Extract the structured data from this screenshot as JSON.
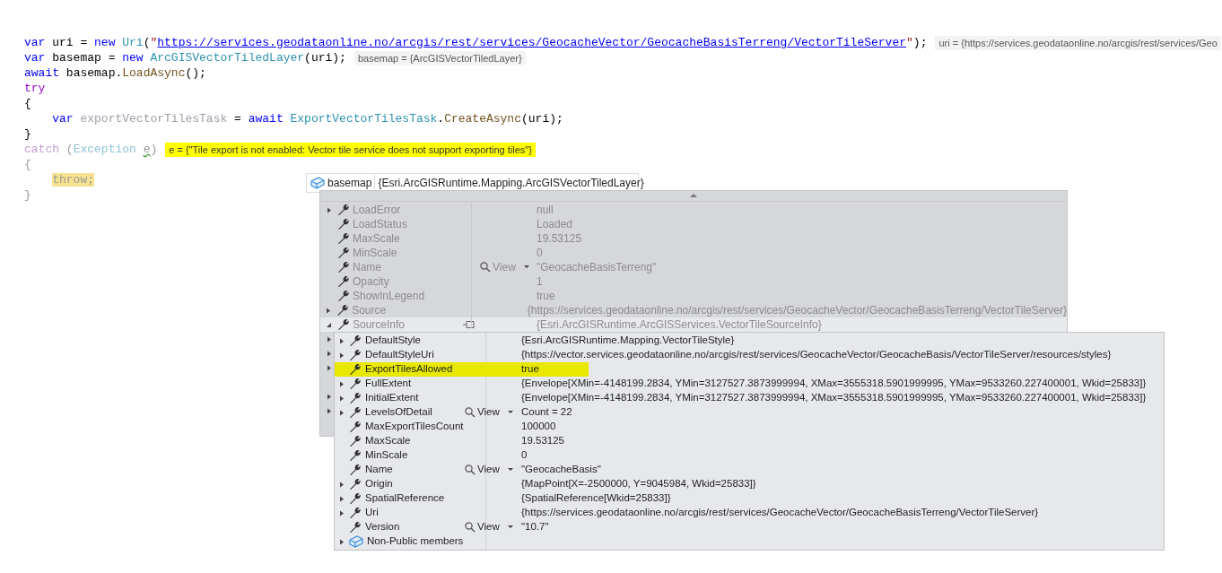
{
  "code_lines": [
    {
      "tokens": [
        {
          "kind": "keyword",
          "text": "var"
        },
        {
          "kind": "plain",
          "text": " uri = "
        },
        {
          "kind": "keyword",
          "text": "new"
        },
        {
          "kind": "type",
          "text": " Uri"
        },
        {
          "kind": "plain",
          "text": "("
        },
        {
          "kind": "string",
          "text": "\""
        },
        {
          "kind": "link",
          "text": "https://services.geodataonline.no/arcgis/rest/services/GeocacheVector/GeocacheBasisTerreng/VectorTileServer"
        },
        {
          "kind": "string",
          "text": "\""
        },
        {
          "kind": "plain",
          "text": ");"
        }
      ],
      "hint": {
        "kind": "datatip",
        "text": "uri = {https://services.geodataonline.no/arcgis/rest/services/Geo"
      }
    },
    {
      "tokens": [
        {
          "kind": "keyword",
          "text": "var"
        },
        {
          "kind": "plain",
          "text": " basemap = "
        },
        {
          "kind": "keyword",
          "text": "new"
        },
        {
          "kind": "type",
          "text": " ArcGISVectorTiledLayer"
        },
        {
          "kind": "plain",
          "text": "(uri);"
        }
      ],
      "hint": {
        "kind": "datatip",
        "text": "basemap = {ArcGISVectorTiledLayer}"
      }
    },
    {
      "tokens": [
        {
          "kind": "keyword",
          "text": "await"
        },
        {
          "kind": "plain",
          "text": " basemap."
        },
        {
          "kind": "method",
          "text": "LoadAsync"
        },
        {
          "kind": "plain",
          "text": "();"
        }
      ]
    },
    {
      "tokens": [
        {
          "kind": "control",
          "text": "try"
        }
      ]
    },
    {
      "tokens": [
        {
          "kind": "plain",
          "text": "{"
        }
      ]
    },
    {
      "tokens": [
        {
          "kind": "keyword",
          "text": "    var"
        },
        {
          "kind": "unused",
          "text": " exportVectorTilesTask"
        },
        {
          "kind": "plain",
          "text": " = "
        },
        {
          "kind": "keyword",
          "text": "await"
        },
        {
          "kind": "type",
          "text": " ExportVectorTilesTask"
        },
        {
          "kind": "plain",
          "text": "."
        },
        {
          "kind": "method",
          "text": "CreateAsync"
        },
        {
          "kind": "plain",
          "text": "(uri);"
        }
      ]
    },
    {
      "tokens": [
        {
          "kind": "plain",
          "text": "}"
        }
      ]
    },
    {
      "tokens": [
        {
          "kind": "control-faded",
          "text": "catch"
        },
        {
          "kind": "faded",
          "text": " ("
        },
        {
          "kind": "type-faded",
          "text": "Exception"
        },
        {
          "kind": "squiggle",
          "text": " e"
        },
        {
          "kind": "faded",
          "text": ")"
        }
      ],
      "hint": {
        "kind": "highlighted",
        "text": "e = {\"Tile export is not enabled: Vector tile service does not support exporting tiles\"}"
      }
    },
    {
      "tokens": [
        {
          "kind": "faded",
          "text": "{"
        }
      ]
    },
    {
      "tokens": [
        {
          "kind": "current",
          "text": "    throw;"
        }
      ]
    },
    {
      "tokens": [
        {
          "kind": "faded",
          "text": "}"
        }
      ]
    }
  ],
  "datatip": {
    "name": "basemap",
    "value": "{Esri.ArcGISRuntime.Mapping.ArcGISVectorTiledLayer}",
    "rows": [
      {
        "name": "LoadError",
        "value": "null",
        "expandable": true,
        "expanded": false,
        "selected": false
      },
      {
        "name": "LoadStatus",
        "value": "Loaded",
        "expandable": false,
        "expanded": false,
        "selected": false
      },
      {
        "name": "MaxScale",
        "value": "19.53125",
        "expandable": false,
        "expanded": false,
        "selected": false
      },
      {
        "name": "MinScale",
        "value": "0",
        "expandable": false,
        "expanded": false,
        "selected": false
      },
      {
        "name": "Name",
        "value": "\"GeocacheBasisTerreng\"",
        "view": "View",
        "expandable": false,
        "expanded": false,
        "selected": false
      },
      {
        "name": "Opacity",
        "value": "1",
        "expandable": false,
        "expanded": false,
        "selected": false
      },
      {
        "name": "ShowInLegend",
        "value": "true",
        "expandable": false,
        "expanded": false,
        "selected": false
      },
      {
        "name": "Source",
        "value": "{https://services.geodataonline.no/arcgis/rest/services/GeocacheVector/GeocacheBasisTerreng/VectorTileServer}",
        "expandable": true,
        "expanded": false,
        "selected": false
      },
      {
        "name": "SourceInfo",
        "value": "{Esri.ArcGISRuntime.ArcGISServices.VectorTileSourceInfo}",
        "expandable": true,
        "expanded": true,
        "selected": true
      }
    ],
    "hidden_row_expanders": [
      true,
      true,
      true,
      false,
      true,
      true
    ],
    "children": [
      {
        "kind": "property",
        "name": "DefaultStyle",
        "value": "{Esri.ArcGISRuntime.Mapping.VectorTileStyle}",
        "expandable": true,
        "highlighted": false
      },
      {
        "kind": "property",
        "name": "DefaultStyleUri",
        "value": "{https://vector.services.geodataonline.no/arcgis/rest/services/GeocacheVector/GeocacheBasis/VectorTileServer/resources/styles}",
        "expandable": true,
        "highlighted": false
      },
      {
        "kind": "property",
        "name": "ExportTilesAllowed",
        "value": "true",
        "expandable": false,
        "highlighted": true
      },
      {
        "kind": "property",
        "name": "FullExtent",
        "value": "{Envelope[XMin=-4148199.2834, YMin=3127527.3873999994, XMax=3555318.5901999995, YMax=9533260.227400001, Wkid=25833]}",
        "expandable": true,
        "highlighted": false
      },
      {
        "kind": "property",
        "name": "InitialExtent",
        "value": "{Envelope[XMin=-4148199.2834, YMin=3127527.3873999994, XMax=3555318.5901999995, YMax=9533260.227400001, Wkid=25833]}",
        "expandable": true,
        "highlighted": false
      },
      {
        "kind": "property",
        "name": "LevelsOfDetail",
        "value": "Count = 22",
        "view": "View",
        "expandable": true,
        "highlighted": false
      },
      {
        "kind": "property",
        "name": "MaxExportTilesCount",
        "value": "100000",
        "expandable": false,
        "highlighted": false
      },
      {
        "kind": "property",
        "name": "MaxScale",
        "value": "19.53125",
        "expandable": false,
        "highlighted": false
      },
      {
        "kind": "property",
        "name": "MinScale",
        "value": "0",
        "expandable": false,
        "highlighted": false
      },
      {
        "kind": "property",
        "name": "Name",
        "value": "\"GeocacheBasis\"",
        "view": "View",
        "expandable": false,
        "highlighted": false
      },
      {
        "kind": "property",
        "name": "Origin",
        "value": "{MapPoint[X=-2500000, Y=9045984, Wkid=25833]}",
        "expandable": true,
        "highlighted": false
      },
      {
        "kind": "property",
        "name": "SpatialReference",
        "value": "{SpatialReference[Wkid=25833]}",
        "expandable": true,
        "highlighted": false
      },
      {
        "kind": "property",
        "name": "Uri",
        "value": "{https://services.geodataonline.no/arcgis/rest/services/GeocacheVector/GeocacheBasisTerreng/VectorTileServer}",
        "expandable": true,
        "highlighted": false
      },
      {
        "kind": "property",
        "name": "Version",
        "value": "\"10.7\"",
        "view": "View",
        "expandable": false,
        "highlighted": false
      },
      {
        "kind": "members",
        "name": "Non-Public members",
        "expandable": true,
        "highlighted": false
      }
    ]
  }
}
